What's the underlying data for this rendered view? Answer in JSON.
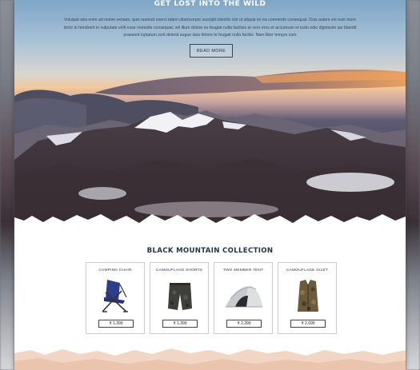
{
  "hero": {
    "title": "GET LOST INTO THE WILD",
    "paragraph": "Volutpat wisi enim ad minim veniam, quis nostrud exerci tation ullamcorper suscipit lobortis nisl ut aliquip ex ea commodo consequat. Duis autem vel eum iriure dolor in hendrerit in vulputate velit esse molestie consequat, vel illum dolore eu feugiat nulla facilisis at vero eros et accumsan et iusto odio dignissim qui blandit praesent luptatum zzril delenit augue duis dolore te feugait nulla facilisi. Nam liber tempor cum",
    "button_label": "READ MORE"
  },
  "collection": {
    "title": "BLACK MOUNTAIN COLLECTION",
    "products": [
      {
        "name": "CAMPING CHAIR",
        "price": "₹ 1,399",
        "icon": "camping-chair-icon"
      },
      {
        "name": "CAMOUFLAGE SHORTS",
        "price": "₹ 1,399",
        "icon": "shorts-icon"
      },
      {
        "name": "TWO MEMBER TENT",
        "price": "₹ 2,399",
        "icon": "tent-icon"
      },
      {
        "name": "CAMOUFLAGE GILET",
        "price": "₹ 2,699",
        "icon": "gilet-icon"
      }
    ]
  },
  "colors": {
    "title_navy": "#1f3448",
    "text_gray": "#3b4452",
    "sand_band": "#f1d6c6"
  }
}
